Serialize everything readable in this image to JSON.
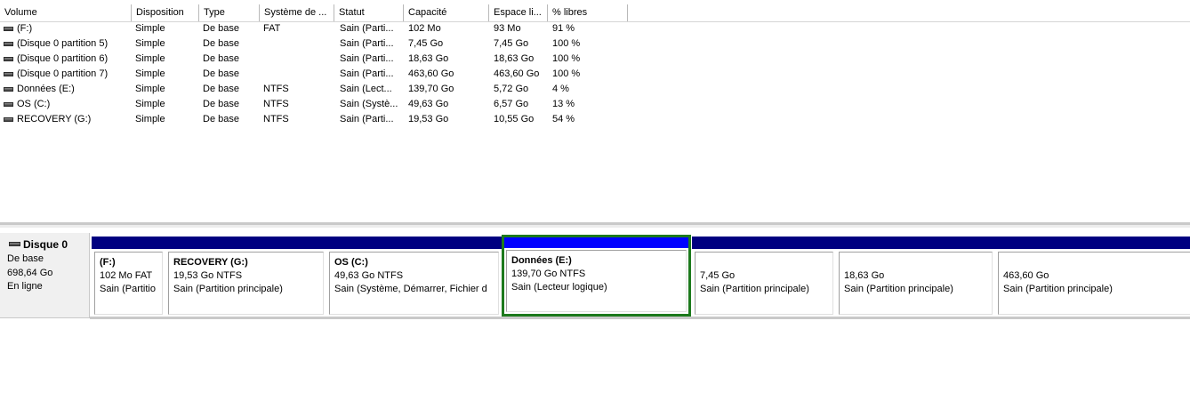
{
  "columns": [
    {
      "label": "Volume"
    },
    {
      "label": "Disposition"
    },
    {
      "label": "Type"
    },
    {
      "label": "Système de ..."
    },
    {
      "label": "Statut"
    },
    {
      "label": "Capacité"
    },
    {
      "label": "Espace li..."
    },
    {
      "label": "% libres"
    }
  ],
  "volumes": [
    {
      "volume": " (F:)",
      "disposition": "Simple",
      "type": "De base",
      "fs": "FAT",
      "status": "Sain (Parti...",
      "capacity": "102 Mo",
      "free": "93 Mo",
      "pct": "91 %"
    },
    {
      "volume": "(Disque 0 partition 5)",
      "disposition": "Simple",
      "type": "De base",
      "fs": "",
      "status": "Sain (Parti...",
      "capacity": "7,45 Go",
      "free": "7,45 Go",
      "pct": "100 %"
    },
    {
      "volume": "(Disque 0 partition 6)",
      "disposition": "Simple",
      "type": "De base",
      "fs": "",
      "status": "Sain (Parti...",
      "capacity": "18,63 Go",
      "free": "18,63 Go",
      "pct": "100 %"
    },
    {
      "volume": "(Disque 0 partition 7)",
      "disposition": "Simple",
      "type": "De base",
      "fs": "",
      "status": "Sain (Parti...",
      "capacity": "463,60 Go",
      "free": "463,60 Go",
      "pct": "100 %"
    },
    {
      "volume": "Données (E:)",
      "disposition": "Simple",
      "type": "De base",
      "fs": "NTFS",
      "status": "Sain (Lect...",
      "capacity": "139,70 Go",
      "free": "5,72 Go",
      "pct": "4 %"
    },
    {
      "volume": "OS (C:)",
      "disposition": "Simple",
      "type": "De base",
      "fs": "NTFS",
      "status": "Sain (Systè...",
      "capacity": "49,63 Go",
      "free": "6,57 Go",
      "pct": "13 %"
    },
    {
      "volume": "RECOVERY (G:)",
      "disposition": "Simple",
      "type": "De base",
      "fs": "NTFS",
      "status": "Sain (Parti...",
      "capacity": "19,53 Go",
      "free": "10,55 Go",
      "pct": "54 %"
    }
  ],
  "disk": {
    "name": "Disque 0",
    "type": "De base",
    "size": "698,64 Go",
    "state": "En ligne"
  },
  "partitions": [
    {
      "name": "(F:)",
      "size": "102 Mo FAT",
      "status": "Sain (Partitio"
    },
    {
      "name": "RECOVERY  (G:)",
      "size": "19,53 Go NTFS",
      "status": "Sain (Partition principale)"
    },
    {
      "name": "OS  (C:)",
      "size": "49,63 Go NTFS",
      "status": "Sain (Système, Démarrer, Fichier d"
    },
    {
      "name": "Données  (E:)",
      "size": "139,70 Go NTFS",
      "status": "Sain (Lecteur logique)"
    },
    {
      "name": "",
      "size": "7,45 Go",
      "status": "Sain (Partition principale)"
    },
    {
      "name": "",
      "size": "18,63 Go",
      "status": "Sain (Partition principale)"
    },
    {
      "name": "",
      "size": "463,60 Go",
      "status": "Sain (Partition principale)"
    }
  ],
  "colors": {
    "primary_partition_bar": "#000080",
    "selected_partition_bar": "#0000ff",
    "selection_border": "#1d7a1d"
  }
}
